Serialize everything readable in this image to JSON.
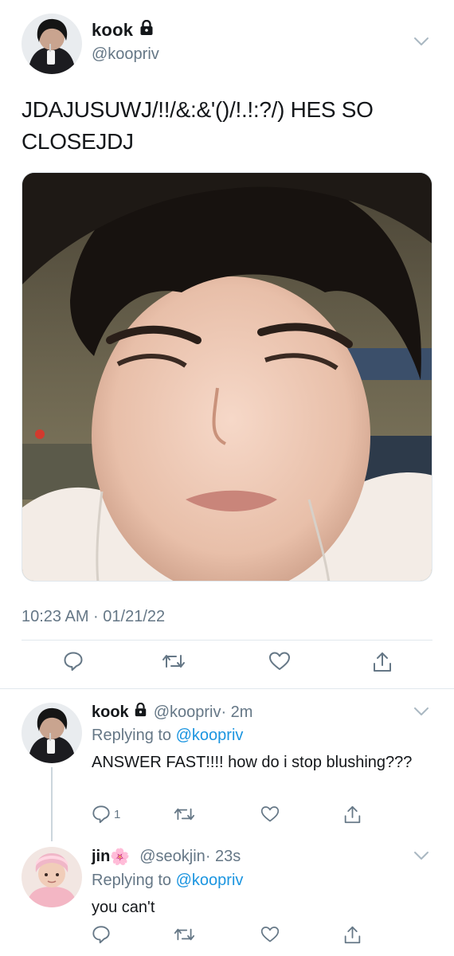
{
  "main_tweet": {
    "display_name": "kook",
    "handle": "@koopriv",
    "text": "JDAJUSUWJ/!!/&:&'()/!.!:?/) HES SO CLOSEJDJ",
    "timestamp": "10:23 AM · 01/21/22",
    "icons": [
      "lock-icon",
      "chevron-down-icon",
      "reply-icon",
      "retweet-icon",
      "like-icon",
      "share-icon"
    ]
  },
  "replies": [
    {
      "display_name": "kook",
      "handle": "@koopriv",
      "age": "· 2m",
      "replying_prefix": "Replying to",
      "replying_handle": "@koopriv",
      "text": "ANSWER FAST!!!! how do i stop blushing???",
      "reply_count": "1"
    },
    {
      "display_name": "jin",
      "emoji": "🌸",
      "handle": "@seokjin",
      "age": "· 23s",
      "replying_prefix": "Replying to",
      "replying_handle": "@koopriv",
      "text": "you can't",
      "reply_count": ""
    }
  ],
  "colors": {
    "text": "#14171a",
    "muted": "#657786",
    "link": "#1b95e0",
    "divider": "#e1e8ed",
    "icon": "#657786"
  }
}
